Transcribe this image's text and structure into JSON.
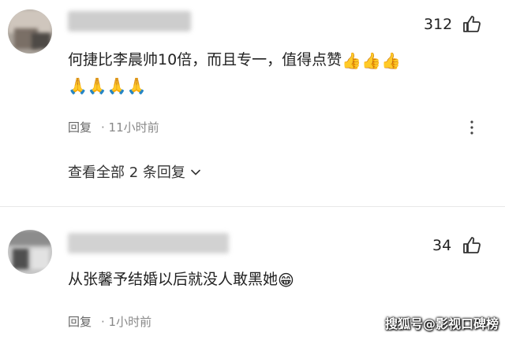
{
  "comments": [
    {
      "like_count": "312",
      "text_line1": "何捷比李晨帅10倍，而且专一，值得点赞",
      "emoji_line1": [
        "thumbs-up",
        "thumbs-up",
        "thumbs-up"
      ],
      "emoji_line2": [
        "folded-hands",
        "folded-hands",
        "folded-hands",
        "folded-hands"
      ],
      "reply_label": "回复",
      "time": "11小时前",
      "view_all_label": "查看全部 2 条回复"
    },
    {
      "like_count": "34",
      "text_line1": "从张馨予结婚以后就没人敢黑她",
      "emoji_line1": [
        "grinning-face"
      ],
      "reply_label": "回复",
      "time": "1小时前"
    }
  ],
  "glyphs": {
    "thumbs-up": "👍",
    "folded-hands": "🙏",
    "grinning-face": "😁",
    "more": "⋮",
    "chevron": "⌄"
  },
  "watermark": "搜狐号@影视口碑榜"
}
